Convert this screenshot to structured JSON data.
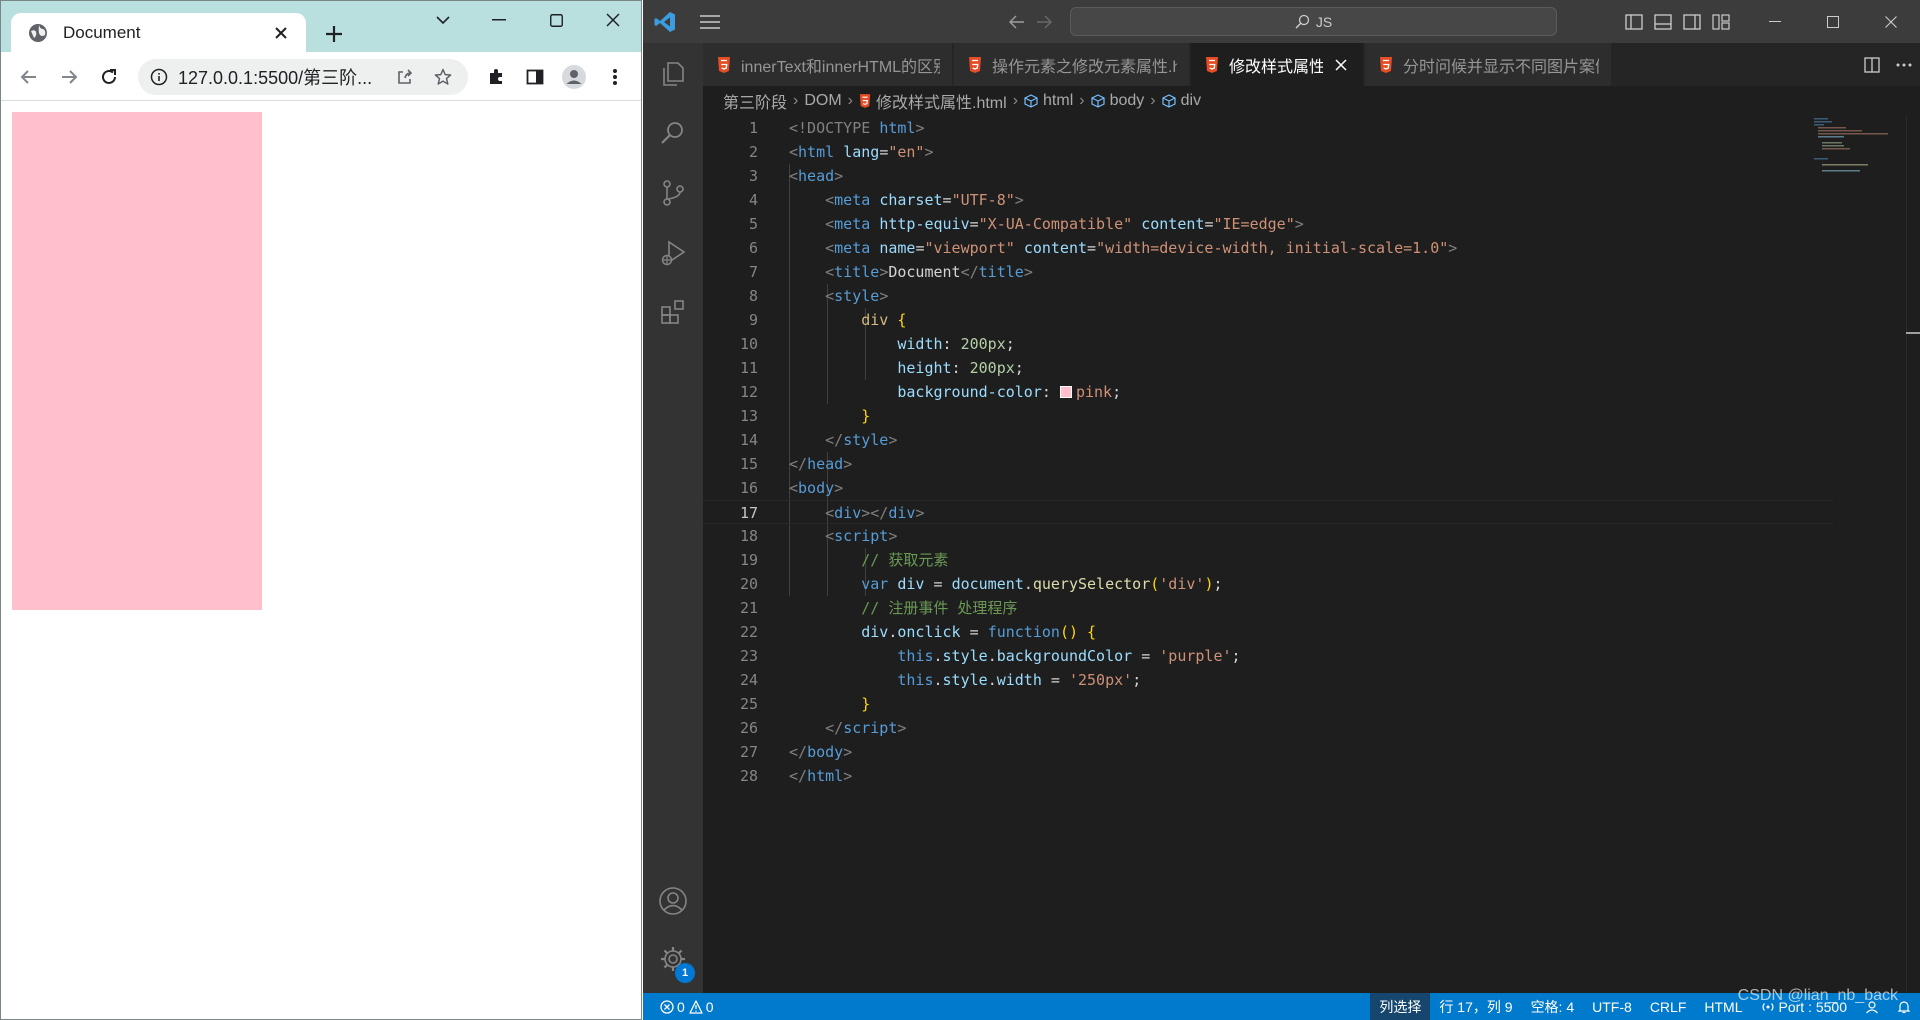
{
  "browser": {
    "tab_title": "Document",
    "url": "127.0.0.1:5500/第三阶...",
    "page": {
      "box_color": "#ffc0cb"
    }
  },
  "vscode": {
    "command_center": "JS",
    "tabs": [
      {
        "label": "innerText和innerHTML的区别.html"
      },
      {
        "label": "操作元素之修改元素属性.html"
      },
      {
        "label": "修改样式属性.html"
      },
      {
        "label": "分时问候并显示不同图片案例.html"
      }
    ],
    "active_tab_index": 2,
    "breadcrumb": [
      "第三阶段",
      "DOM",
      "修改样式属性.html",
      "html",
      "body",
      "div"
    ],
    "settings_badge": "1",
    "code": {
      "line_numbers": [
        "1",
        "2",
        "3",
        "4",
        "5",
        "6",
        "7",
        "8",
        "9",
        "10",
        "11",
        "12",
        "13",
        "14",
        "15",
        "16",
        "17",
        "18",
        "19",
        "20",
        "21",
        "22",
        "23",
        "24",
        "25",
        "26",
        "27",
        "28"
      ],
      "current_line": "17",
      "l1": {
        "doctype": "<!DOCTYPE",
        "html": "html",
        "close": ">"
      },
      "l2": {
        "tag": "html",
        "attr": "lang",
        "val": "\"en\""
      },
      "l3": {
        "tag": "head"
      },
      "l4": {
        "tag": "meta",
        "attr": "charset",
        "val": "\"UTF-8\""
      },
      "l5": {
        "tag": "meta",
        "attr1": "http-equiv",
        "val1": "\"X-UA-Compatible\"",
        "attr2": "content",
        "val2": "\"IE=edge\""
      },
      "l6": {
        "tag": "meta",
        "attr1": "name",
        "val1": "\"viewport\"",
        "attr2": "content",
        "val2": "\"width=device-width, initial-scale=1.0\""
      },
      "l7": {
        "tag": "title",
        "text": "Document"
      },
      "l8": {
        "tag": "style"
      },
      "l9": {
        "selector": "div",
        "brace": "{"
      },
      "l10": {
        "prop": "width",
        "value": "200px"
      },
      "l11": {
        "prop": "height",
        "value": "200px"
      },
      "l12": {
        "prop": "background-color",
        "value": "pink",
        "swatch": "#ffc0cb"
      },
      "l13": {
        "brace": "}"
      },
      "l14": {
        "tag": "style"
      },
      "l15": {
        "tag": "head"
      },
      "l16": {
        "tag": "body"
      },
      "l17": {
        "tag": "div"
      },
      "l18": {
        "tag": "script"
      },
      "l19": {
        "comment": "// 获取元素"
      },
      "l20": {
        "kw": "var",
        "name": "div",
        "obj": "document",
        "fn": "querySelector",
        "arg": "'div'"
      },
      "l21": {
        "comment": "// 注册事件 处理程序"
      },
      "l22": {
        "obj": "div",
        "prop": "onclick",
        "kw": "function"
      },
      "l23": {
        "self": "this",
        "p1": "style",
        "p2": "backgroundColor",
        "val": "'purple'"
      },
      "l24": {
        "self": "this",
        "p1": "style",
        "p2": "width",
        "val": "'250px'"
      },
      "l25": {
        "brace": "}"
      },
      "l26": {
        "tag": "script"
      },
      "l27": {
        "tag": "body"
      },
      "l28": {
        "tag": "html"
      }
    },
    "statusbar": {
      "errors": "0",
      "warnings": "0",
      "selection_mode": "列选择",
      "position": "行 17，列 9",
      "spaces": "空格: 4",
      "encoding": "UTF-8",
      "eol": "CRLF",
      "language": "HTML",
      "port": "Port : 5500"
    },
    "watermark": "CSDN @lian_nb_back"
  },
  "colors": {
    "browser_tabstrip": "#b9e0de",
    "vscode_bg": "#1e1e1e",
    "statusbar": "#007acc",
    "pink": "#ffc0cb"
  }
}
